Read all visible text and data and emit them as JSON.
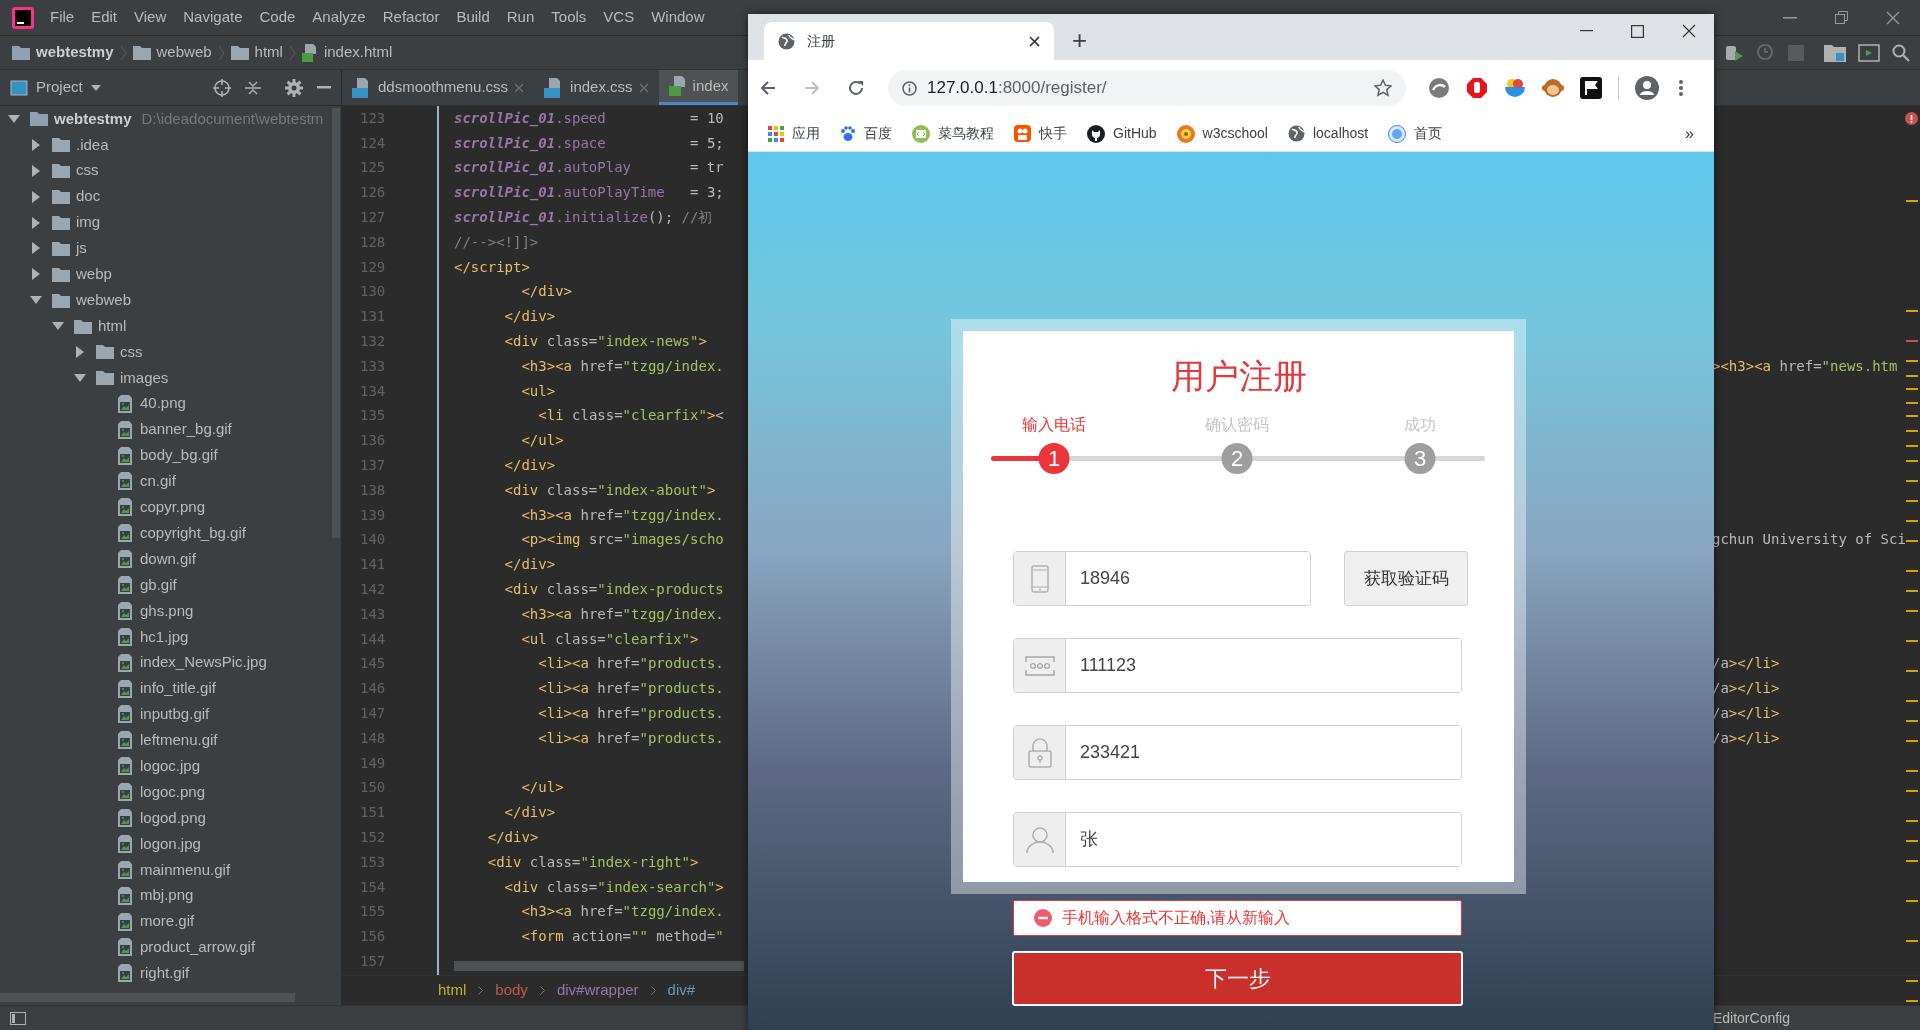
{
  "ide": {
    "menu": [
      "File",
      "Edit",
      "View",
      "Navigate",
      "Code",
      "Analyze",
      "Refactor",
      "Build",
      "Run",
      "Tools",
      "VCS",
      "Window"
    ],
    "breadcrumb": [
      "webtestmy",
      "webweb",
      "html",
      "index.html"
    ],
    "project_panel": {
      "title": "Project",
      "tree": [
        {
          "label": "webtestmy",
          "path": "D:\\ideadocument\\webtestm",
          "kind": "folder",
          "expanded": true,
          "children": [
            {
              "label": ".idea",
              "kind": "folder",
              "expanded": false
            },
            {
              "label": "css",
              "kind": "folder",
              "expanded": false
            },
            {
              "label": "doc",
              "kind": "folder",
              "expanded": false
            },
            {
              "label": "img",
              "kind": "folder",
              "expanded": false
            },
            {
              "label": "js",
              "kind": "folder",
              "expanded": false
            },
            {
              "label": "webp",
              "kind": "folder",
              "expanded": false
            },
            {
              "label": "webweb",
              "kind": "folder",
              "expanded": true,
              "children": [
                {
                  "label": "html",
                  "kind": "folder",
                  "expanded": true,
                  "children": [
                    {
                      "label": "css",
                      "kind": "folder",
                      "expanded": false
                    },
                    {
                      "label": "images",
                      "kind": "folder",
                      "expanded": true,
                      "children": [
                        {
                          "label": "40.png",
                          "kind": "file"
                        },
                        {
                          "label": "banner_bg.gif",
                          "kind": "file"
                        },
                        {
                          "label": "body_bg.gif",
                          "kind": "file"
                        },
                        {
                          "label": "cn.gif",
                          "kind": "file"
                        },
                        {
                          "label": "copyr.png",
                          "kind": "file"
                        },
                        {
                          "label": "copyright_bg.gif",
                          "kind": "file"
                        },
                        {
                          "label": "down.gif",
                          "kind": "file"
                        },
                        {
                          "label": "gb.gif",
                          "kind": "file"
                        },
                        {
                          "label": "ghs.png",
                          "kind": "file"
                        },
                        {
                          "label": "hc1.jpg",
                          "kind": "file"
                        },
                        {
                          "label": "index_NewsPic.jpg",
                          "kind": "file"
                        },
                        {
                          "label": "info_title.gif",
                          "kind": "file"
                        },
                        {
                          "label": "inputbg.gif",
                          "kind": "file"
                        },
                        {
                          "label": "leftmenu.gif",
                          "kind": "file"
                        },
                        {
                          "label": "logoc.jpg",
                          "kind": "file"
                        },
                        {
                          "label": "logoc.png",
                          "kind": "file"
                        },
                        {
                          "label": "logod.png",
                          "kind": "file"
                        },
                        {
                          "label": "logon.jpg",
                          "kind": "file"
                        },
                        {
                          "label": "mainmenu.gif",
                          "kind": "file"
                        },
                        {
                          "label": "mbj.png",
                          "kind": "file"
                        },
                        {
                          "label": "more.gif",
                          "kind": "file"
                        },
                        {
                          "label": "product_arrow.gif",
                          "kind": "file"
                        },
                        {
                          "label": "right.gif",
                          "kind": "file"
                        }
                      ]
                    }
                  ]
                }
              ]
            }
          ]
        }
      ]
    },
    "editor_tabs": [
      {
        "label": "ddsmoothmenu.css",
        "kind": "css",
        "selected": false
      },
      {
        "label": "index.css",
        "kind": "css",
        "selected": false
      },
      {
        "label": "index",
        "kind": "html",
        "selected": true
      }
    ],
    "code_lines": [
      {
        "number": "123",
        "text": "scrollPic_01.speed          = 10"
      },
      {
        "number": "124",
        "text": "scrollPic_01.space          = 5;"
      },
      {
        "number": "125",
        "text": "scrollPic_01.autoPlay       = tr"
      },
      {
        "number": "126",
        "text": "scrollPic_01.autoPlayTime   = 3;"
      },
      {
        "number": "127",
        "text": "scrollPic_01.initialize(); //初"
      },
      {
        "number": "128",
        "text": "//--><!]]>"
      },
      {
        "number": "129",
        "text": "</script>"
      },
      {
        "number": "130",
        "text": "        </div>"
      },
      {
        "number": "131",
        "text": "      </div>"
      },
      {
        "number": "132",
        "text": "      <div class=\"index-news\">"
      },
      {
        "number": "133",
        "text": "        <h3><a href=\"tzgg/index.",
        "tail": "><h3><a href=\"news.htm"
      },
      {
        "number": "134",
        "text": "        <ul>"
      },
      {
        "number": "135",
        "text": "          <li class=\"clearfix\"><"
      },
      {
        "number": "136",
        "text": "        </ul>"
      },
      {
        "number": "137",
        "text": "      </div>"
      },
      {
        "number": "138",
        "text": "      <div class=\"index-about\">"
      },
      {
        "number": "139",
        "text": "        <h3><a href=\"tzgg/index."
      },
      {
        "number": "140",
        "text": "        <p><img src=\"images/scho",
        "tail": "gchun University of Sci"
      },
      {
        "number": "141",
        "text": "      </div>"
      },
      {
        "number": "142",
        "text": "      <div class=\"index-products"
      },
      {
        "number": "143",
        "text": "        <h3><a href=\"tzgg/index."
      },
      {
        "number": "144",
        "text": "        <ul class=\"clearfix\">"
      },
      {
        "number": "145",
        "text": "          <li><a href=\"products.",
        "tail": "/a></li>"
      },
      {
        "number": "146",
        "text": "          <li><a href=\"products.",
        "tail": "/a></li>"
      },
      {
        "number": "147",
        "text": "          <li><a href=\"products.",
        "tail": "/a></li>"
      },
      {
        "number": "148",
        "text": "          <li><a href=\"products.",
        "tail": "/a></li>"
      },
      {
        "number": "149"
      },
      {
        "number": "150",
        "text": "        </ul>"
      },
      {
        "number": "151",
        "text": "      </div>"
      },
      {
        "number": "152",
        "text": "    </div>"
      },
      {
        "number": "153",
        "text": "    <div class=\"index-right\">"
      },
      {
        "number": "154",
        "text": "      <div class=\"index-search\">"
      },
      {
        "number": "155",
        "text": "        <h3><a href=\"tzgg/index."
      },
      {
        "number": "156",
        "text": "        <form action=\"\" method=\""
      },
      {
        "number": "157"
      }
    ],
    "editor_breadcrumb": [
      "html",
      "body",
      "div#wrapper",
      "div#"
    ],
    "status_bar": {
      "text": "EditorConfig"
    }
  },
  "browser": {
    "tab": {
      "title": "注册"
    },
    "new_tab": "+",
    "address": {
      "host": "127.0.0.1",
      "path": ":8000/register/"
    },
    "bookmarks": [
      "应用",
      "百度",
      "菜鸟教程",
      "快手",
      "GitHub",
      "w3cschool",
      "localhost",
      "首页"
    ],
    "more": "»",
    "page": {
      "title": "用户注册",
      "steps": [
        {
          "label": "输入电话",
          "number": "1",
          "active": true
        },
        {
          "label": "确认密码",
          "number": "2",
          "active": false
        },
        {
          "label": "成功",
          "number": "3",
          "active": false
        }
      ],
      "fields": [
        {
          "kind": "phone",
          "value": "18946",
          "button": "获取验证码"
        },
        {
          "kind": "code",
          "value": "111123"
        },
        {
          "kind": "password",
          "value": "233421"
        },
        {
          "kind": "user",
          "value": "张"
        }
      ],
      "error": "手机输入格式不正确,请从新输入",
      "submit": "下一步"
    }
  }
}
